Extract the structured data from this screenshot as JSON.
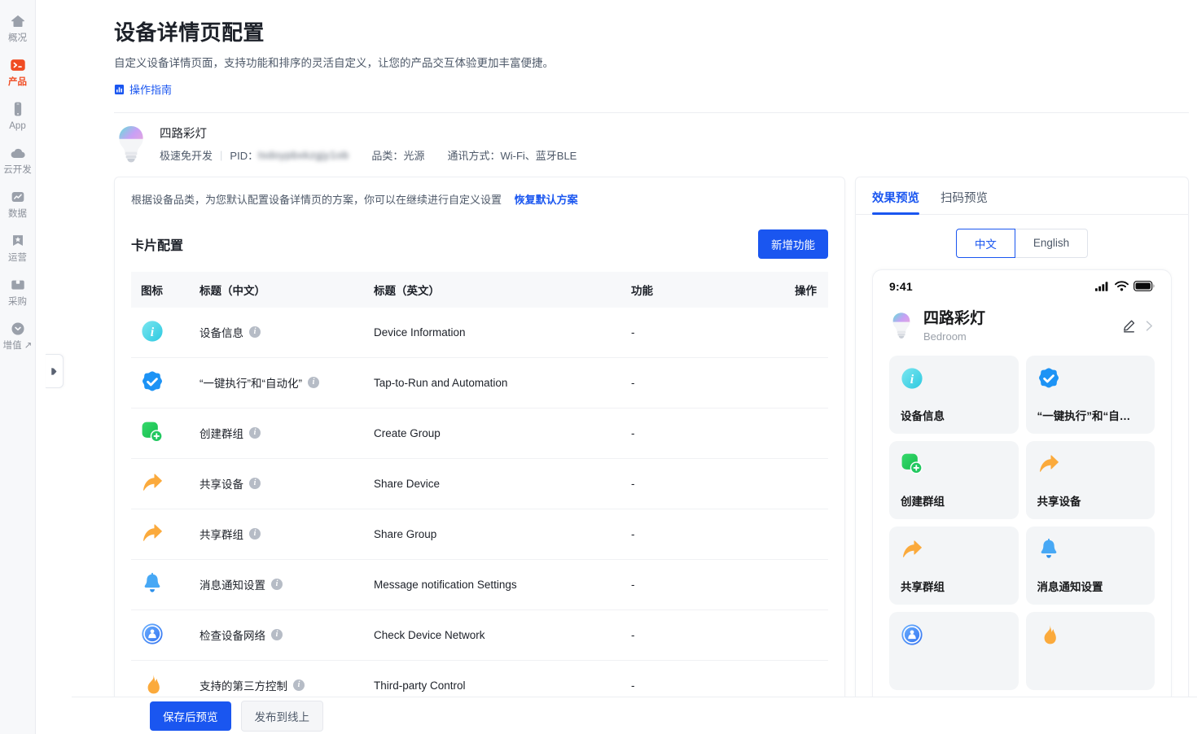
{
  "rail": {
    "items": [
      {
        "label": "概况",
        "icon": "home-icon",
        "active": false
      },
      {
        "label": "产品",
        "icon": "terminal-icon",
        "active": true
      },
      {
        "label": "App",
        "icon": "phone-icon",
        "active": false
      },
      {
        "label": "云开发",
        "icon": "cloud-icon",
        "active": false
      },
      {
        "label": "数据",
        "icon": "chart-icon",
        "active": false
      },
      {
        "label": "运营",
        "icon": "star-badge-icon",
        "active": false
      },
      {
        "label": "采购",
        "icon": "box-icon",
        "active": false
      },
      {
        "label": "增值 ↗",
        "icon": "chevron-circle-icon",
        "active": false
      }
    ]
  },
  "header": {
    "title": "设备详情页配置",
    "subtitle": "自定义设备详情页面，支持功能和排序的灵活自定义，让您的产品交互体验更加丰富便捷。",
    "guide_label": "操作指南"
  },
  "device": {
    "name": "四路彩灯",
    "dev_mode": "极速免开发",
    "pid_label": "PID：",
    "pid_value": "tsdoypbxkzgjy1ob",
    "category_label": "品类：",
    "category_value": "光源",
    "comm_label": "通讯方式：",
    "comm_value": "Wi-Fi、蓝牙BLE"
  },
  "config": {
    "notice": "根据设备品类，为您默认配置设备详情页的方案，你可以在继续进行自定义设置",
    "restore_label": "恢复默认方案",
    "section_title": "卡片配置",
    "add_label": "新增功能",
    "columns": [
      "图标",
      "标题（中文）",
      "标题（英文）",
      "功能",
      "操作"
    ],
    "rows": [
      {
        "icon": "info-circle-icon",
        "cn": "设备信息",
        "en": "Device Information",
        "fn": "-",
        "op": ""
      },
      {
        "icon": "check-shield-icon",
        "cn": "“一键执行”和“自动化”",
        "en": "Tap-to-Run and Automation",
        "fn": "-",
        "op": ""
      },
      {
        "icon": "group-add-icon",
        "cn": "创建群组",
        "en": "Create Group",
        "fn": "-",
        "op": ""
      },
      {
        "icon": "share-arrow-icon",
        "cn": "共享设备",
        "en": "Share Device",
        "fn": "-",
        "op": ""
      },
      {
        "icon": "share-arrow-icon",
        "cn": "共享群组",
        "en": "Share Group",
        "fn": "-",
        "op": ""
      },
      {
        "icon": "bell-icon",
        "cn": "消息通知设置",
        "en": "Message notification Settings",
        "fn": "-",
        "op": ""
      },
      {
        "icon": "network-check-icon",
        "cn": "检查设备网络",
        "en": "Check Device Network",
        "fn": "-",
        "op": ""
      },
      {
        "icon": "flame-icon",
        "cn": "支持的第三方控制",
        "en": "Third-party Control",
        "fn": "-",
        "op": ""
      }
    ]
  },
  "preview": {
    "tabs": [
      {
        "label": "效果预览",
        "active": true
      },
      {
        "label": "扫码预览",
        "active": false
      }
    ],
    "languages": [
      {
        "label": "中文",
        "active": true
      },
      {
        "label": "English",
        "active": false
      }
    ],
    "phone": {
      "clock": "9:41",
      "device_title": "四路彩灯",
      "room": "Bedroom",
      "tiles": [
        {
          "icon": "info-circle-icon",
          "label": "设备信息"
        },
        {
          "icon": "check-shield-icon",
          "label": "“一键执行”和“自…"
        },
        {
          "icon": "group-add-icon",
          "label": "创建群组"
        },
        {
          "icon": "share-arrow-icon",
          "label": "共享设备"
        },
        {
          "icon": "share-arrow-icon",
          "label": "共享群组"
        },
        {
          "icon": "bell-icon",
          "label": "消息通知设置"
        },
        {
          "icon": "network-check-icon",
          "label": ""
        },
        {
          "icon": "flame-icon",
          "label": ""
        }
      ]
    }
  },
  "footer": {
    "save_label": "保存后预览",
    "publish_label": "发布到线上"
  },
  "colors": {
    "brand_blue": "#1a56f0",
    "product_orange": "#f04c23",
    "info_cyan": "#4dd6e8",
    "green": "#22c55e",
    "amber": "#fbaa3c"
  }
}
